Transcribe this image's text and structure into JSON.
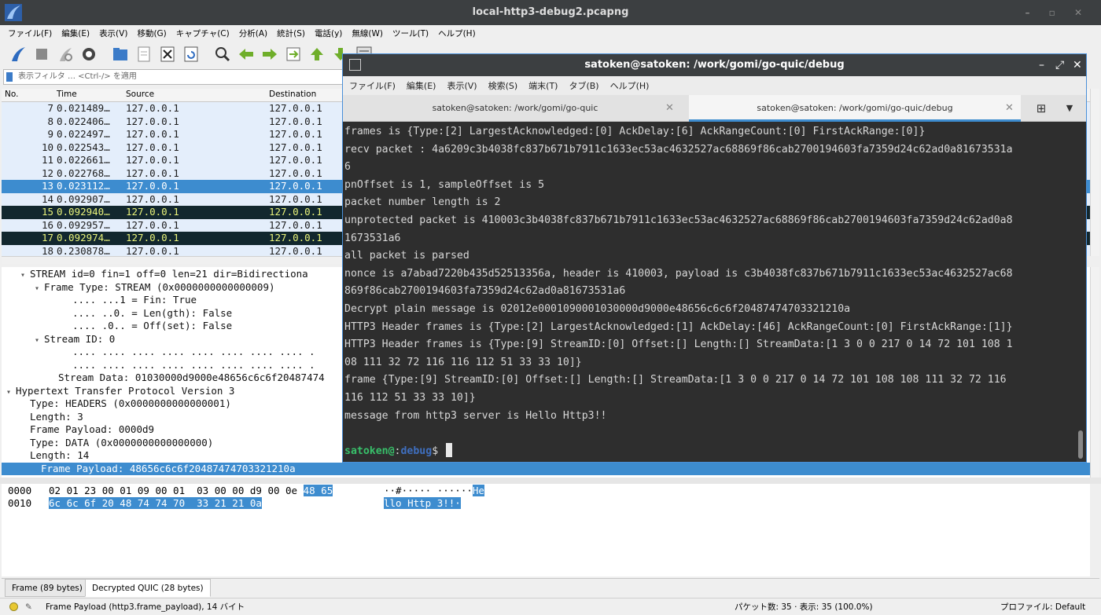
{
  "wireshark": {
    "window_title": "local-http3-debug2.pcapng",
    "menu": [
      "ファイル(F)",
      "編集(E)",
      "表示(V)",
      "移動(G)",
      "キャプチャ(C)",
      "分析(A)",
      "統計(S)",
      "電話(y)",
      "無線(W)",
      "ツール(T)",
      "ヘルプ(H)"
    ],
    "filter_placeholder": "表示フィルタ … <Ctrl-/> を適用",
    "columns": [
      "No.",
      "Time",
      "Source",
      "Destination"
    ],
    "packets": [
      {
        "no": "7",
        "time": "0.021489…",
        "src": "127.0.0.1",
        "dst": "127.0.0.1",
        "style": "normal"
      },
      {
        "no": "8",
        "time": "0.022406…",
        "src": "127.0.0.1",
        "dst": "127.0.0.1",
        "style": "normal"
      },
      {
        "no": "9",
        "time": "0.022497…",
        "src": "127.0.0.1",
        "dst": "127.0.0.1",
        "style": "normal"
      },
      {
        "no": "10",
        "time": "0.022543…",
        "src": "127.0.0.1",
        "dst": "127.0.0.1",
        "style": "normal"
      },
      {
        "no": "11",
        "time": "0.022661…",
        "src": "127.0.0.1",
        "dst": "127.0.0.1",
        "style": "normal"
      },
      {
        "no": "12",
        "time": "0.022768…",
        "src": "127.0.0.1",
        "dst": "127.0.0.1",
        "style": "normal"
      },
      {
        "no": "13",
        "time": "0.023112…",
        "src": "127.0.0.1",
        "dst": "127.0.0.1",
        "style": "selected"
      },
      {
        "no": "14",
        "time": "0.092907…",
        "src": "127.0.0.1",
        "dst": "127.0.0.1",
        "style": "normal"
      },
      {
        "no": "15",
        "time": "0.092940…",
        "src": "127.0.0.1",
        "dst": "127.0.0.1",
        "style": "dark"
      },
      {
        "no": "16",
        "time": "0.092957…",
        "src": "127.0.0.1",
        "dst": "127.0.0.1",
        "style": "normal"
      },
      {
        "no": "17",
        "time": "0.092974…",
        "src": "127.0.0.1",
        "dst": "127.0.0.1",
        "style": "dark"
      },
      {
        "no": "18",
        "time": "0.230878…",
        "src": "127.0.0.1",
        "dst": "127.0.0.1",
        "style": "normal"
      }
    ],
    "details": [
      {
        "text": "STREAM id=0 fin=1 off=0 len=21 dir=Bidirectiona",
        "twisty": "open",
        "indent": 1
      },
      {
        "text": "Frame Type: STREAM (0x0000000000000009)",
        "twisty": "open",
        "indent": 2
      },
      {
        "text": ".... ...1 = Fin: True",
        "twisty": "",
        "indent": 4
      },
      {
        "text": ".... ..0. = Len(gth): False",
        "twisty": "",
        "indent": 4
      },
      {
        "text": ".... .0.. = Off(set): False",
        "twisty": "",
        "indent": 4
      },
      {
        "text": "Stream ID: 0",
        "twisty": "open",
        "indent": 2
      },
      {
        "text": ".... .... .... .... .... .... .... .... .",
        "twisty": "",
        "indent": 4
      },
      {
        "text": ".... .... .... .... .... .... .... .... .",
        "twisty": "",
        "indent": 4
      },
      {
        "text": "Stream Data: 01030000d9000e48656c6c6f20487474",
        "twisty": "",
        "indent": 3
      },
      {
        "text": "Hypertext Transfer Protocol Version 3",
        "twisty": "open",
        "indent": 0
      },
      {
        "text": "Type: HEADERS (0x0000000000000001)",
        "twisty": "",
        "indent": 1
      },
      {
        "text": "Length: 3",
        "twisty": "",
        "indent": 1
      },
      {
        "text": "Frame Payload: 0000d9",
        "twisty": "",
        "indent": 1
      },
      {
        "text": "Type: DATA (0x0000000000000000)",
        "twisty": "",
        "indent": 1
      },
      {
        "text": "Length: 14",
        "twisty": "",
        "indent": 1
      },
      {
        "text": "Frame Payload: 48656c6c6f20487474703321210a",
        "twisty": "",
        "indent": 1,
        "selected": true
      }
    ],
    "bytes": {
      "row0_offset": "0000",
      "row0_hex_plain": "02 01 23 00 01 09 00 01  03 00 00 d9 00 0e ",
      "row0_hex_hl": "48 65",
      "row0_ascii_plain": "··#····· ······",
      "row0_ascii_hl": "He",
      "row1_offset": "0010",
      "row1_hex_hl": "6c 6c 6f 20 48 74 74 70  33 21 21 0a",
      "row1_ascii_hl": "llo Http 3!!·"
    },
    "bytes_tabs": [
      "Frame (89 bytes)",
      "Decrypted QUIC (28 bytes)"
    ],
    "status": {
      "field": "Frame Payload (http3.frame_payload), 14 バイト",
      "packets": "パケット数: 35 · 表示: 35 (100.0%)",
      "profile": "プロファイル: Default"
    }
  },
  "terminal": {
    "title": "satoken@satoken: /work/gomi/go-quic/debug",
    "menu": [
      "ファイル(F)",
      "編集(E)",
      "表示(V)",
      "検索(S)",
      "端末(T)",
      "タブ(B)",
      "ヘルプ(H)"
    ],
    "tabs": [
      {
        "label": "satoken@satoken: /work/gomi/go-quic",
        "active": false
      },
      {
        "label": "satoken@satoken: /work/gomi/go-quic/debug",
        "active": true
      }
    ],
    "lines": [
      "frames is {Type:[2] LargestAcknowledged:[0] AckDelay:[6] AckRangeCount:[0] FirstAckRange:[0]}",
      "recv packet : 4a6209c3b4038fc837b671b7911c1633ec53ac4632527ac68869f86cab2700194603fa7359d24c62ad0a81673531a",
      "6",
      "pnOffset is 1, sampleOffset is 5",
      "packet number length is 2",
      "unprotected packet is 410003c3b4038fc837b671b7911c1633ec53ac4632527ac68869f86cab2700194603fa7359d24c62ad0a8",
      "1673531a6",
      "all packet is parsed",
      "nonce is a7abad7220b435d52513356a, header is 410003, payload is c3b4038fc837b671b7911c1633ec53ac4632527ac68",
      "869f86cab2700194603fa7359d24c62ad0a81673531a6",
      "Decrypt plain message is 02012e0001090001030000d9000e48656c6c6f20487474703321210a",
      "HTTP3 Header frames is {Type:[2] LargestAcknowledged:[1] AckDelay:[46] AckRangeCount:[0] FirstAckRange:[1]}",
      "HTTP3 Header frames is {Type:[9] StreamID:[0] Offset:[] Length:[] StreamData:[1 3 0 0 217 0 14 72 101 108 1",
      "08 111 32 72 116 116 112 51 33 33 10]}",
      "frame {Type:[9] StreamID:[0] Offset:[] Length:[] StreamData:[1 3 0 0 217 0 14 72 101 108 108 111 32 72 116",
      "116 112 51 33 33 10]}",
      "message from http3 server is Hello Http3!!",
      ""
    ],
    "prompt": {
      "user": "satoken@",
      "sep": ":",
      "dir": "debug",
      "symbol": "$ "
    }
  },
  "colors": {
    "selection": "#3d8ccf",
    "row_bg": "#e4eefb",
    "dark_row_bg": "#12272e",
    "dark_row_fg": "#e8f27a",
    "prompt_user": "#38c06a",
    "prompt_dir": "#3f6fbf"
  }
}
